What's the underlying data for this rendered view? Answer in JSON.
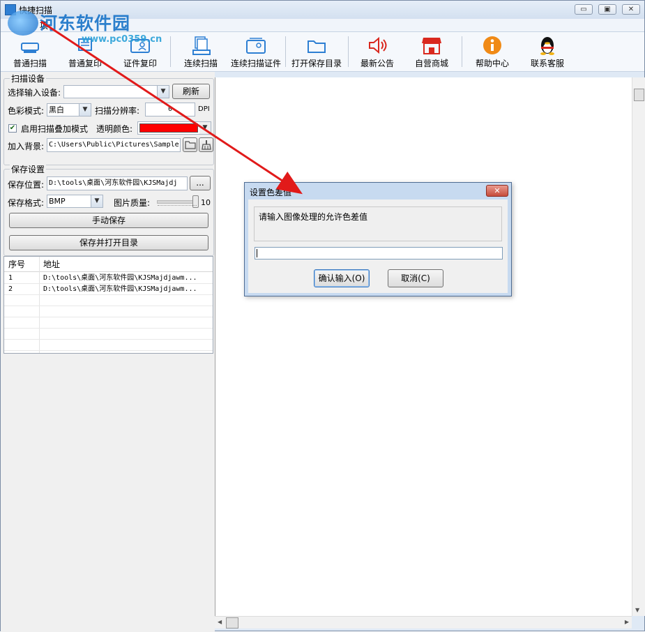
{
  "window": {
    "title": "快捷扫描",
    "menu_label": "项",
    "minimize_glyph": "▭",
    "restore_glyph": "▣",
    "close_glyph": "✕"
  },
  "watermark": {
    "brand": "河东软件园",
    "url": "www.pc0359.cn"
  },
  "toolbar": {
    "buttons": [
      {
        "label": "普通扫描",
        "icon": "scanner-icon"
      },
      {
        "label": "普通复印",
        "icon": "copier-icon"
      },
      {
        "label": "证件复印",
        "icon": "id-card-icon"
      },
      {
        "label": "连续扫描",
        "icon": "continuous-scan-icon"
      },
      {
        "label": "连续扫描证件",
        "icon": "continuous-id-scan-icon"
      },
      {
        "label": "打开保存目录",
        "icon": "folder-open-icon"
      },
      {
        "label": "最新公告",
        "icon": "speaker-icon"
      },
      {
        "label": "自营商城",
        "icon": "store-icon"
      },
      {
        "label": "帮助中心",
        "icon": "info-icon"
      },
      {
        "label": "联系客服",
        "icon": "qq-penguin-icon"
      }
    ]
  },
  "scan_settings": {
    "group_title": "扫描设备",
    "device_label": "选择输入设备:",
    "device_value": "",
    "refresh_label": "刷新",
    "color_mode_label": "色彩模式:",
    "color_mode_value": "黑白",
    "resolution_label": "扫描分辨率:",
    "resolution_value": "0",
    "dpi_unit": "DPI",
    "overlay_checkbox_label": "启用扫描叠加模式",
    "overlay_checked": true,
    "transparent_color_label": "透明颜色:",
    "transparent_color": "#ff0000",
    "background_label": "加入背景:",
    "background_path": "C:\\Users\\Public\\Pictures\\Sample"
  },
  "save_settings": {
    "group_title": "保存设置",
    "location_label": "保存位置:",
    "location_value": "D:\\tools\\桌面\\河东软件园\\KJSMajdj",
    "browse_label": "...",
    "format_label": "保存格式:",
    "format_value": "BMP",
    "quality_label": "图片质量:",
    "quality_value": "10",
    "manual_save_label": "手动保存",
    "save_open_label": "保存并打开目录"
  },
  "file_table": {
    "columns": [
      "序号",
      "地址"
    ],
    "rows": [
      {
        "index": "1",
        "path": "D:\\tools\\桌面\\河东软件园\\KJSMajdjawm..."
      },
      {
        "index": "2",
        "path": "D:\\tools\\桌面\\河东软件园\\KJSMajdjawm..."
      }
    ]
  },
  "dialog": {
    "title": "设置色差值",
    "close_glyph": "✕",
    "message": "请输入图像处理的允许色差值",
    "input_value": "",
    "ok_label": "确认输入(O)",
    "cancel_label": "取消(C)"
  },
  "annotation": {
    "arrow_color": "#e11a1a"
  }
}
